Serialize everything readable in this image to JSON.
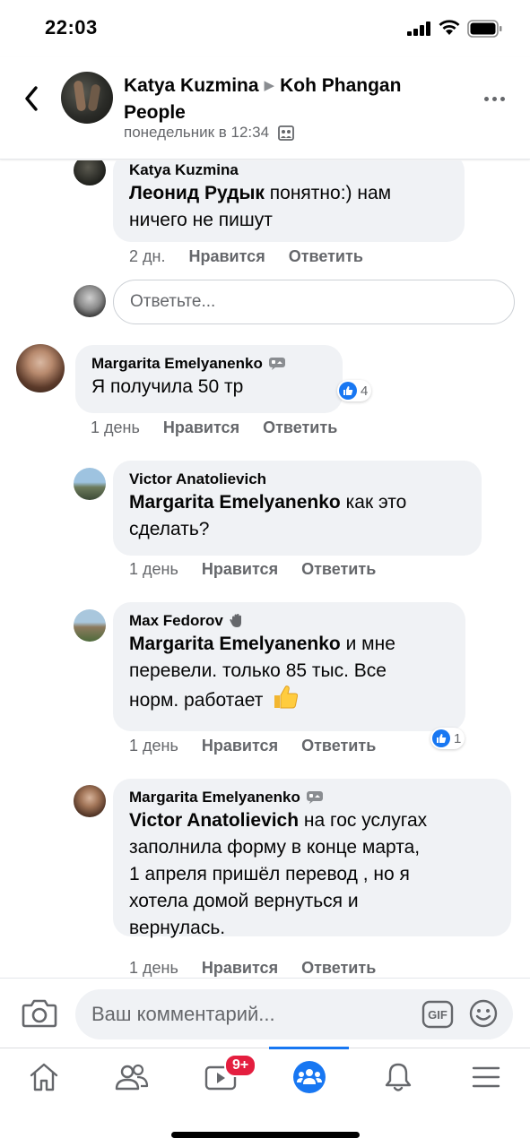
{
  "status": {
    "time": "22:03"
  },
  "header": {
    "author": "Katya Kuzmina",
    "group": "Koh Phangan People",
    "timestamp": "понедельник в 12:34"
  },
  "comments": [
    {
      "author": "Katya Kuzmina",
      "mention": "Леонид Рудык",
      "text_lines": [
        "понятно:) нам",
        "ничего не пишут"
      ],
      "time": "2 дн.",
      "like_label": "Нравится",
      "reply_label": "Ответить"
    },
    {
      "author": "Margarita Emelyanenko",
      "text": "Я получила 50 тр",
      "time": "1 день",
      "like_label": "Нравится",
      "reply_label": "Ответить",
      "reactions": "4"
    },
    {
      "author": "Victor Anatolievich",
      "mention": "Margarita Emelyanenko",
      "text_lines": [
        "как это",
        "сделать?"
      ],
      "time": "1 день",
      "like_label": "Нравится",
      "reply_label": "Ответить"
    },
    {
      "author": "Max Fedorov",
      "mention": "Margarita Emelyanenko",
      "text_lines": [
        "и мне",
        "перевели. только 85 тыс. Все",
        "норм. работает"
      ],
      "time": "1 день",
      "like_label": "Нравится",
      "reply_label": "Ответить",
      "reactions": "1"
    },
    {
      "author": "Margarita Emelyanenko",
      "mention": "Victor Anatolievich",
      "text_lines": [
        "на гос услугах",
        "заполнила форму в конце марта,",
        "1 апреля пришёл перевод , но я",
        "хотела домой вернуться и",
        "вернулась."
      ],
      "time": "1 день",
      "like_label": "Нравится",
      "reply_label": "Ответить"
    }
  ],
  "reply_box": {
    "placeholder": "Ответьте..."
  },
  "comment_box": {
    "placeholder": "Ваш комментарий..."
  },
  "tabs": {
    "notifications_badge": "9+"
  },
  "colors": {
    "accent": "#1877f2",
    "bubble": "#f0f2f5",
    "badge": "#e41e3f"
  }
}
